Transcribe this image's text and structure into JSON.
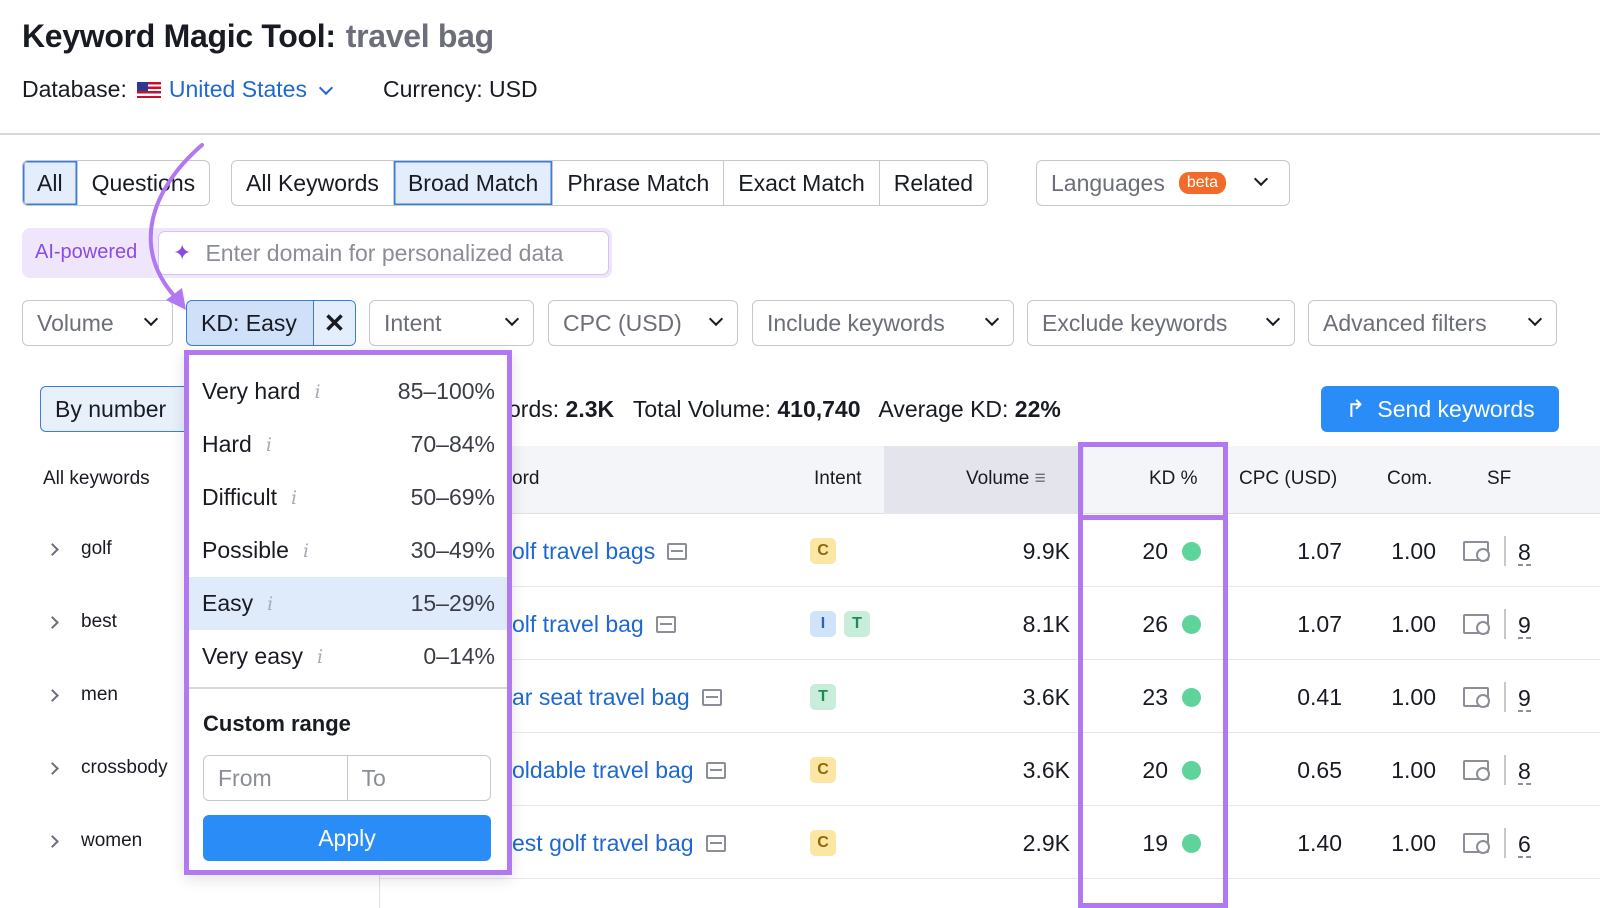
{
  "header": {
    "title": "Keyword Magic Tool:",
    "query": "travel bag",
    "database_label": "Database:",
    "database_value": "United States",
    "currency": "Currency: USD"
  },
  "match_tabs_left": [
    "All",
    "Questions"
  ],
  "match_tabs": [
    "All Keywords",
    "Broad Match",
    "Phrase Match",
    "Exact Match",
    "Related"
  ],
  "selected_tabs": [
    "All",
    "Broad Match"
  ],
  "languages": {
    "label": "Languages",
    "badge": "beta"
  },
  "ai": {
    "label": "AI-powered",
    "placeholder": "Enter domain for personalized data"
  },
  "filters": {
    "volume": "Volume",
    "kd": "KD: Easy",
    "intent": "Intent",
    "cpc": "CPC (USD)",
    "include": "Include keywords",
    "exclude": "Exclude keywords",
    "advanced": "Advanced filters"
  },
  "toolbar": {
    "by_number": "By number",
    "stats_keywords_label": "ords:",
    "stats_keywords_value": "2.3K",
    "stats_volume_label": "Total Volume:",
    "stats_volume_value": "410,740",
    "stats_kd_label": "Average KD:",
    "stats_kd_value": "22%",
    "send": "Send keywords"
  },
  "sidebar": {
    "header": "All keywords",
    "items": [
      "golf",
      "best",
      "men",
      "crossbody",
      "women"
    ]
  },
  "table": {
    "headers": {
      "keyword": "ord",
      "intent": "Intent",
      "volume": "Volume",
      "kd": "KD %",
      "cpc": "CPC (USD)",
      "com": "Com.",
      "sf": "SF"
    },
    "rows": [
      {
        "keyword": "olf travel bags",
        "intents": [
          "C"
        ],
        "volume": "9.9K",
        "kd": "20",
        "cpc": "1.07",
        "com": "1.00",
        "sf": "8"
      },
      {
        "keyword": "olf travel bag",
        "intents": [
          "I",
          "T"
        ],
        "volume": "8.1K",
        "kd": "26",
        "cpc": "1.07",
        "com": "1.00",
        "sf": "9"
      },
      {
        "keyword": "ar seat travel bag",
        "intents": [
          "T"
        ],
        "volume": "3.6K",
        "kd": "23",
        "cpc": "0.41",
        "com": "1.00",
        "sf": "9"
      },
      {
        "keyword": "oldable travel bag",
        "intents": [
          "C"
        ],
        "volume": "3.6K",
        "kd": "20",
        "cpc": "0.65",
        "com": "1.00",
        "sf": "8"
      },
      {
        "keyword": "est golf travel bag",
        "intents": [
          "C"
        ],
        "volume": "2.9K",
        "kd": "19",
        "cpc": "1.40",
        "com": "1.00",
        "sf": "6"
      }
    ]
  },
  "kd_dropdown": {
    "options": [
      {
        "label": "Very hard",
        "range": "85–100%"
      },
      {
        "label": "Hard",
        "range": "70–84%"
      },
      {
        "label": "Difficult",
        "range": "50–69%"
      },
      {
        "label": "Possible",
        "range": "30–49%"
      },
      {
        "label": "Easy",
        "range": "15–29%"
      },
      {
        "label": "Very easy",
        "range": "0–14%"
      }
    ],
    "selected": "Easy",
    "info_glyph": "i",
    "custom_range": "Custom range",
    "from_placeholder": "From",
    "to_placeholder": "To",
    "apply": "Apply"
  },
  "colors": {
    "accent": "#2a8cf6",
    "highlight": "#b178f0",
    "kd_dot": "#5fd49a",
    "link": "#1f68d2"
  }
}
